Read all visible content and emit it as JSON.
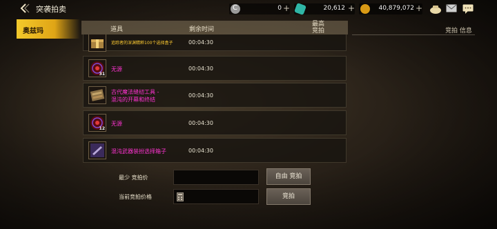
{
  "topbar": {
    "title": "突袭拍卖",
    "currencies": [
      {
        "icon": "c-coin-icon",
        "value": "0",
        "color": "#c8c8c8"
      },
      {
        "icon": "teal-gem-icon",
        "value": "20,612",
        "color": "#3fc7b4"
      },
      {
        "icon": "gold-coin-icon",
        "value": "40,879,072",
        "color": "#e0a21a"
      }
    ]
  },
  "sidebar": {
    "active_tab": "奥兹玛"
  },
  "table": {
    "col_item": "道具",
    "col_time": "剩余时间",
    "col_max_bid": "最高\n竞拍",
    "bid_info": "竞拍 信息",
    "rows": [
      {
        "name": "追踪者的深渊精粹100个选择盒子",
        "time": "00:04:30",
        "icon": "gold-box-icon",
        "badge": ""
      },
      {
        "name": "无源",
        "time": "00:04:30",
        "icon": "red-orb-icon",
        "badge": "31"
      },
      {
        "name": "古代魔法缝纫工具 -\n混沌的开幕和终结",
        "time": "00:04:30",
        "icon": "sewing-kit-icon",
        "badge": ""
      },
      {
        "name": "无源",
        "time": "00:04:30",
        "icon": "red-orb-icon",
        "badge": "12"
      },
      {
        "name": "混沌武器装扮选择箱子",
        "time": "00:04:30",
        "icon": "purple-box-icon",
        "badge": ""
      }
    ]
  },
  "bid": {
    "min_label": "最少 竞拍价",
    "current_label": "当前竞拍价格",
    "free_bid_label": "自由 竞拍",
    "bid_label": "竞拍"
  },
  "colors": {
    "accent_tab": "#f3c92b",
    "item_name": "#ff33d2",
    "small_name": "#ffcc33"
  }
}
